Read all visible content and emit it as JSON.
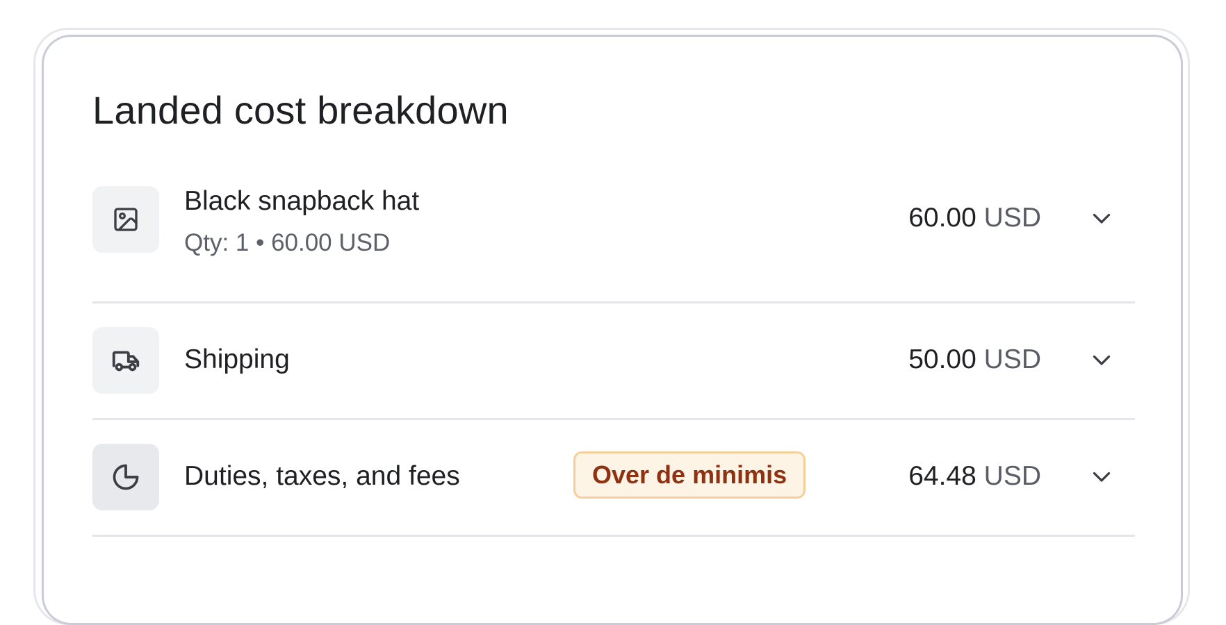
{
  "card": {
    "title": "Landed cost breakdown"
  },
  "rows": [
    {
      "icon": "image-icon",
      "name": "Black snapback hat",
      "subtitle": "Qty: 1 • 60.00 USD",
      "amount": "60.00",
      "currency": "USD"
    },
    {
      "icon": "truck-icon",
      "name": "Shipping",
      "amount": "50.00",
      "currency": "USD"
    },
    {
      "icon": "pie-chart-icon",
      "name": "Duties, taxes, and fees",
      "badge": "Over de minimis",
      "amount": "64.48",
      "currency": "USD"
    }
  ],
  "colors": {
    "badge_text": "#8e3212",
    "badge_bg": "#fdf4e6",
    "badge_border": "#f4cf9c"
  }
}
